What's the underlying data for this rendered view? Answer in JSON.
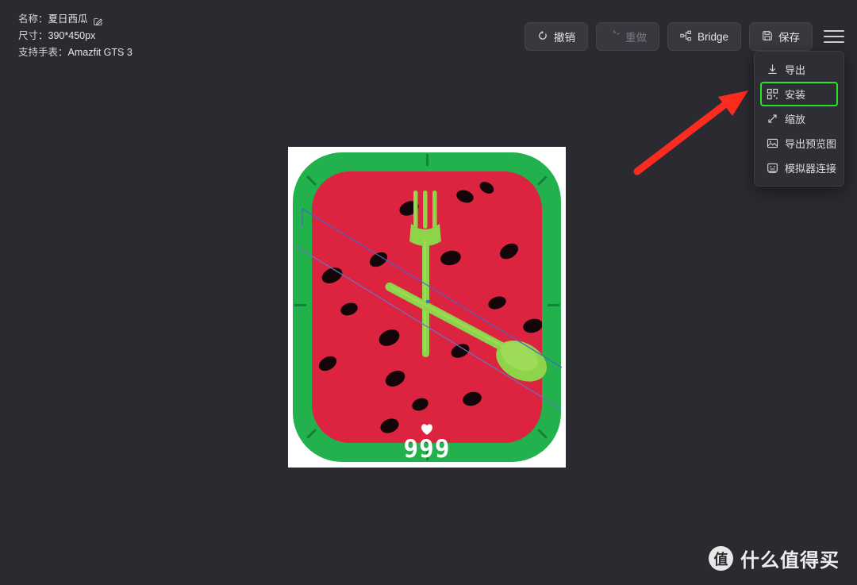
{
  "info": {
    "name_label": "名称：",
    "name_value": "夏日西瓜",
    "edit_icon": "edit-pencil-icon",
    "size_label": "尺寸：",
    "size_value": "390*450px",
    "watch_label": "支持手表：",
    "watch_value": "Amazfit GTS 3"
  },
  "toolbar": {
    "undo_label": "撤销",
    "redo_label": "重做",
    "bridge_label": "Bridge",
    "save_label": "保存",
    "menu_icon": "hamburger-menu-icon"
  },
  "menu": {
    "items": [
      {
        "label": "导出",
        "icon": "export-download-icon",
        "highlighted": false
      },
      {
        "label": "安装",
        "icon": "qrcode-install-icon",
        "highlighted": true
      },
      {
        "label": "缩放",
        "icon": "scale-arrow-icon",
        "highlighted": false
      },
      {
        "label": "导出预览图",
        "icon": "image-picture-icon",
        "highlighted": false
      },
      {
        "label": "模拟器连接",
        "icon": "simulator-monitor-icon",
        "highlighted": false
      }
    ]
  },
  "annotation": {
    "arrow_color": "#fb2b20",
    "highlight_color": "#27e327"
  },
  "preview": {
    "heart_icon": "heart-icon",
    "step_count": "999",
    "colors": {
      "rim_green": "#22b14c",
      "flesh_red": "#dc2340",
      "seed_black": "#140608",
      "utensil_green": "#8ed44a",
      "guide_blue": "#4a63c8",
      "background": "#ffffff"
    },
    "seeds": [
      [
        110,
        38,
        25,
        17,
        -22
      ],
      [
        182,
        24,
        22,
        15,
        18
      ],
      [
        72,
        103,
        24,
        16,
        -30
      ],
      [
        211,
        14,
        19,
        13,
        30
      ],
      [
        162,
        100,
        26,
        18,
        -12
      ],
      [
        236,
        92,
        25,
        17,
        -32
      ],
      [
        12,
        122,
        27,
        18,
        -25
      ],
      [
        36,
        166,
        22,
        15,
        -18
      ],
      [
        222,
        158,
        23,
        15,
        -20
      ],
      [
        266,
        186,
        25,
        17,
        -15
      ],
      [
        84,
        200,
        27,
        19,
        -26
      ],
      [
        175,
        218,
        24,
        16,
        -24
      ],
      [
        8,
        234,
        24,
        16,
        -30
      ],
      [
        92,
        252,
        26,
        18,
        -28
      ],
      [
        126,
        286,
        21,
        15,
        -20
      ],
      [
        190,
        278,
        24,
        17,
        -15
      ],
      [
        86,
        312,
        24,
        17,
        -22
      ]
    ]
  },
  "watermark": {
    "logo_char": "值",
    "text": "什么值得买"
  }
}
